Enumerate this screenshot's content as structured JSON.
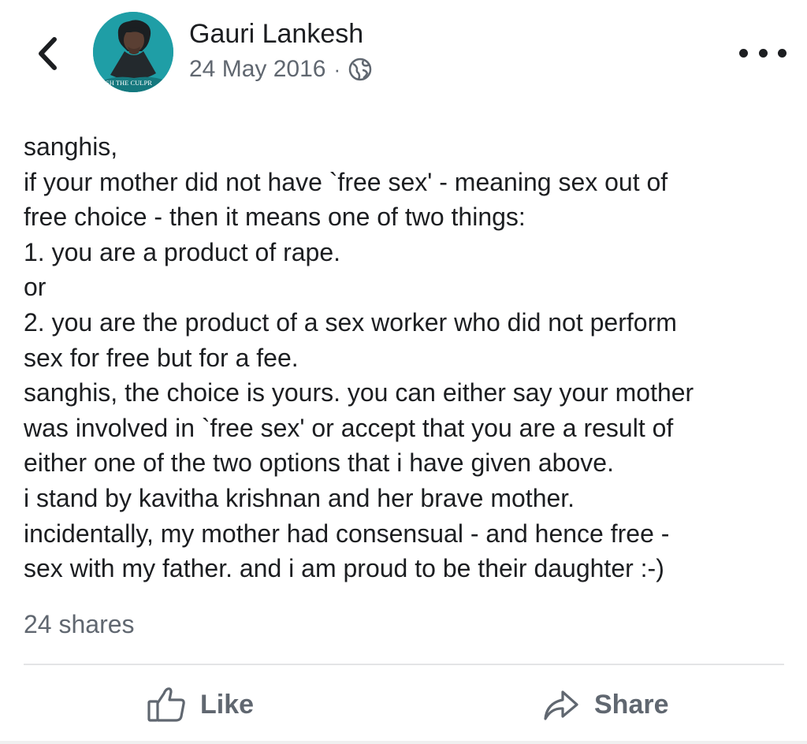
{
  "header": {
    "back_icon": "chevron-left-icon",
    "author_name": "Gauri Lankesh",
    "avatar_caption": "SH THE CULPR",
    "date": "24 May 2016",
    "separator": "·",
    "privacy_icon": "globe-icon",
    "more_icon": "more-dots-icon"
  },
  "post": {
    "lines": [
      "sanghis,",
      "if your mother did not have `free sex' - meaning sex out of",
      "free choice - then it means one of two things:",
      "1. you are a product of rape.",
      "or",
      "2. you are the product of a sex worker who did not perform",
      "sex for free but for a fee.",
      "sanghis, the choice is yours. you can either say your mother",
      "was involved in `free sex' or accept that you are a result of",
      "either one of the two options that i have given above.",
      "i stand by kavitha krishnan and her brave mother.",
      "incidentally, my mother had consensual - and hence free -",
      "sex with my father. and i am proud to be their daughter :-)"
    ],
    "shares": "24 shares"
  },
  "actions": {
    "like_label": "Like",
    "like_icon": "thumbs-up-icon",
    "share_label": "Share",
    "share_icon": "share-arrow-icon"
  },
  "colors": {
    "text_primary": "#1c1e21",
    "text_secondary": "#606770",
    "avatar_bg": "#1f9ea6",
    "divider": "#e3e4e6"
  }
}
